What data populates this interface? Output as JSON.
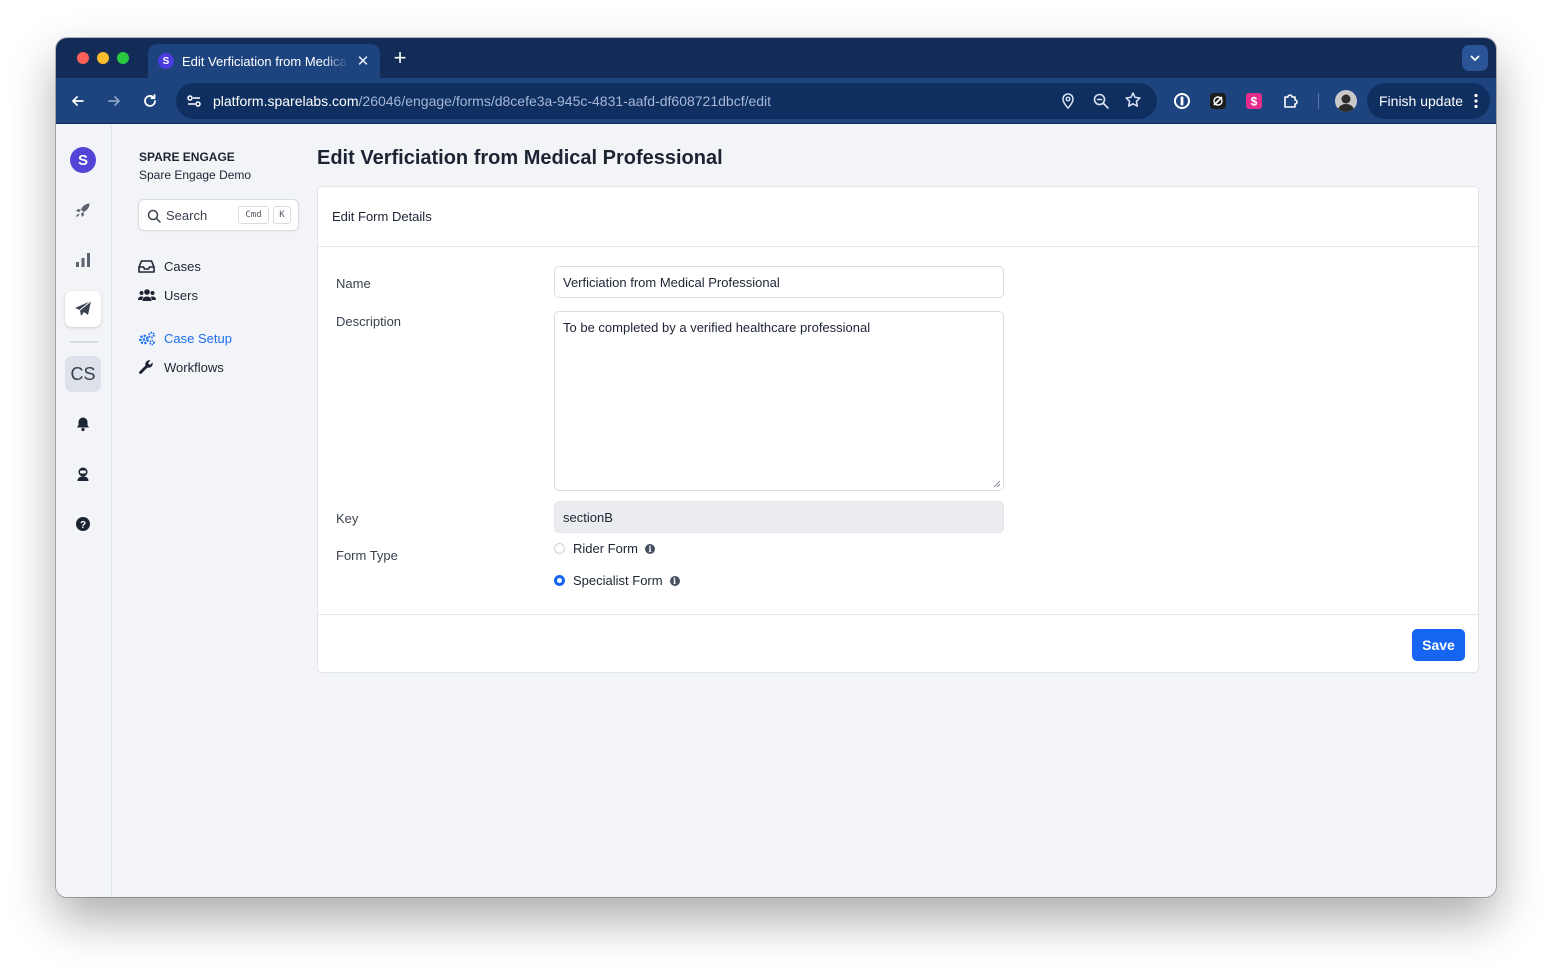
{
  "browser": {
    "tab_title": "Edit Verficiation from Medical Professional",
    "tab_favicon_letter": "S",
    "url_host": "platform.sparelabs.com",
    "url_path": "/26046/engage/forms/d8cefe3a-945c-4831-aafd-df608721dbcf/edit",
    "finish_update_label": "Finish update"
  },
  "rail": {
    "logo_letter": "S",
    "workspace_initials": "CS",
    "items": [
      "rocket-icon",
      "bar-chart-icon",
      "paper-plane-icon",
      "bell-icon",
      "astronaut-icon",
      "help-icon"
    ]
  },
  "sidebar": {
    "brand_title": "SPARE ENGAGE",
    "brand_subtitle": "Spare Engage Demo",
    "search_placeholder": "Search",
    "kbd_cmd": "Cmd",
    "kbd_k": "K",
    "items": [
      {
        "label": "Cases",
        "icon": "inbox-icon"
      },
      {
        "label": "Users",
        "icon": "users-icon"
      },
      {
        "label": "Case Setup",
        "icon": "cogs-icon",
        "active": true
      },
      {
        "label": "Workflows",
        "icon": "wrench-icon"
      }
    ]
  },
  "page": {
    "title": "Edit Verficiation from Medical Professional",
    "card_title": "Edit Form Details",
    "form": {
      "name_label": "Name",
      "name_value": "Verficiation from Medical Professional",
      "description_label": "Description",
      "description_value": "To be completed by a verified healthcare professional",
      "key_label": "Key",
      "key_value": "sectionB",
      "form_type_label": "Form Type",
      "form_type_options": [
        {
          "label": "Rider Form",
          "selected": false
        },
        {
          "label": "Specialist Form",
          "selected": true
        }
      ]
    },
    "save_label": "Save"
  },
  "colors": {
    "tab_strip": "#132c57",
    "toolbar": "#1d447f",
    "accent": "#1565f2",
    "brand": "#5245d8"
  }
}
